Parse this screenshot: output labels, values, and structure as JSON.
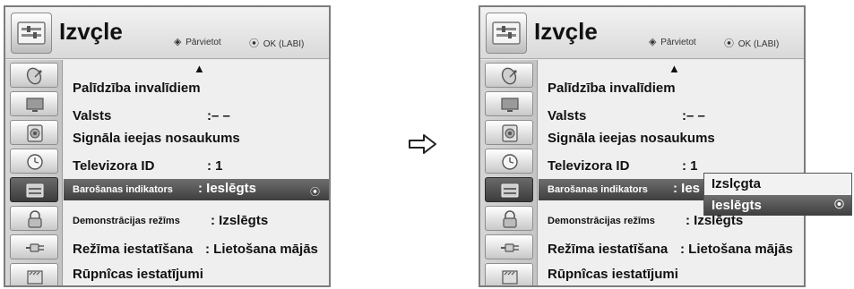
{
  "menu": {
    "title": "Izvçle",
    "hint_nav": "Pārvietot",
    "hint_ok": "OK (LABI)",
    "scroll_up": "▲",
    "nav_glyph": "◈",
    "ok_glyph": "⦿"
  },
  "items": {
    "accessibility": {
      "label": "Palīdzība invalīdiem"
    },
    "country": {
      "label": "Valsts",
      "value": ":– –"
    },
    "input_label": {
      "label": "Signāla ieejas nosaukums"
    },
    "tv_id": {
      "label": "Televizora ID",
      "value": ": 1"
    },
    "power_indicator": {
      "label": "Barošanas indikators",
      "value": ": Ieslēgts",
      "value_truncated": ": Ies"
    },
    "demo_mode": {
      "label": "Demonstrācijas režīms",
      "value": ": Izslēgts",
      "value_obscured": ": Izslēgts"
    },
    "mode_setting": {
      "label": "Režīma iestatīšana",
      "value": ": Lietošana mājās"
    },
    "factory_reset": {
      "label": "Rūpnîcas iestatījumi"
    }
  },
  "popup": {
    "options": [
      "Izslçgta",
      "Ieslēgts"
    ],
    "selected_index": 1
  },
  "colors": {
    "panel_bg": "#e9e9e9",
    "selection_bg": "#4a4a4a",
    "border": "#7c7c7c"
  },
  "sidebar_icons": [
    "satellite-dish-icon",
    "monitor-icon",
    "speaker-icon",
    "clock-icon",
    "option-tools-icon",
    "lock-icon",
    "input-plug-icon",
    "support-icon"
  ],
  "active_sidebar_index": 4
}
